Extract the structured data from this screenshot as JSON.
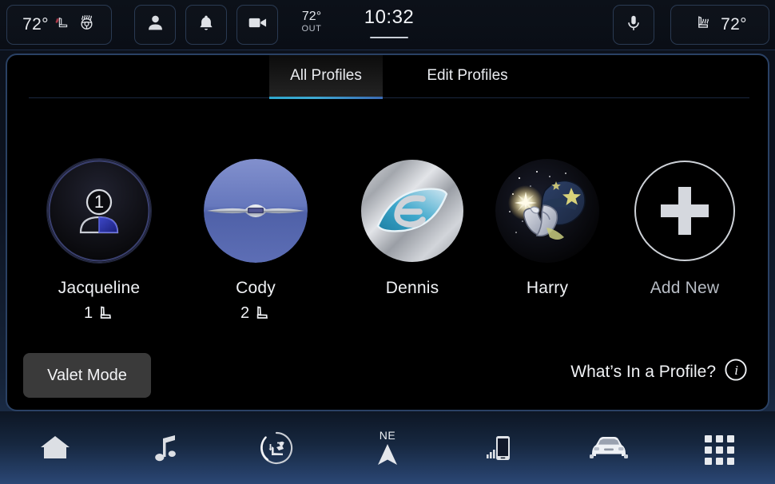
{
  "status_bar": {
    "cabin_temp": "72°",
    "heated_seat_icon": "heated-seat-icon",
    "heated_steering_icon": "heated-steering-wheel-icon",
    "profile_icon": "person-icon",
    "alerts_icon": "bell-icon",
    "camera_icon": "video-camera-icon",
    "outside_temp_value": "72°",
    "outside_temp_label": "OUT",
    "clock": "10:32",
    "voice_icon": "microphone-icon",
    "passenger_seat_icon": "heated-seat-icon",
    "passenger_temp": "72°"
  },
  "tabs": [
    {
      "id": "all-profiles",
      "label": "All Profiles",
      "active": true
    },
    {
      "id": "edit-profiles",
      "label": "Edit Profiles",
      "active": false
    }
  ],
  "profiles": [
    {
      "name": "Jacqueline",
      "seat_memory": "1",
      "avatar": "driver-seat-position-1-avatar",
      "dim": false
    },
    {
      "name": "Cody",
      "seat_memory": "2",
      "avatar": "chrysler-wing-emblem-avatar",
      "dim": false
    },
    {
      "name": "Dennis",
      "seat_memory": "",
      "avatar": "blue-leaf-e-logo-avatar",
      "dim": false
    },
    {
      "name": "Harry",
      "seat_memory": "",
      "avatar": "wizard-avatar",
      "dim": false
    },
    {
      "name": "Add New",
      "seat_memory": "",
      "avatar": "plus-circle-icon",
      "dim": true
    }
  ],
  "actions": {
    "valet_mode": "Valet Mode",
    "whats_in_profile": "What’s In a Profile?",
    "info_icon": "info-icon"
  },
  "bottom_nav": [
    {
      "id": "home",
      "icon": "home-icon",
      "label": ""
    },
    {
      "id": "media",
      "icon": "music-note-icon",
      "label": ""
    },
    {
      "id": "comfort",
      "icon": "climate-comfort-icon",
      "label": ""
    },
    {
      "id": "navigation",
      "icon": "compass-arrow-icon",
      "label": "NE"
    },
    {
      "id": "phone",
      "icon": "phone-signal-icon",
      "label": ""
    },
    {
      "id": "vehicle",
      "icon": "car-front-icon",
      "label": ""
    },
    {
      "id": "apps",
      "icon": "apps-grid-icon",
      "label": ""
    }
  ],
  "colors": {
    "accent_cyan": "#2ea8cf",
    "accent_blue": "#3b6bb5",
    "panel_border": "#2a4164",
    "text_primary": "#f0f2f5",
    "text_dim": "#b7bcc4",
    "heated_seat_red": "#b03a4a"
  }
}
